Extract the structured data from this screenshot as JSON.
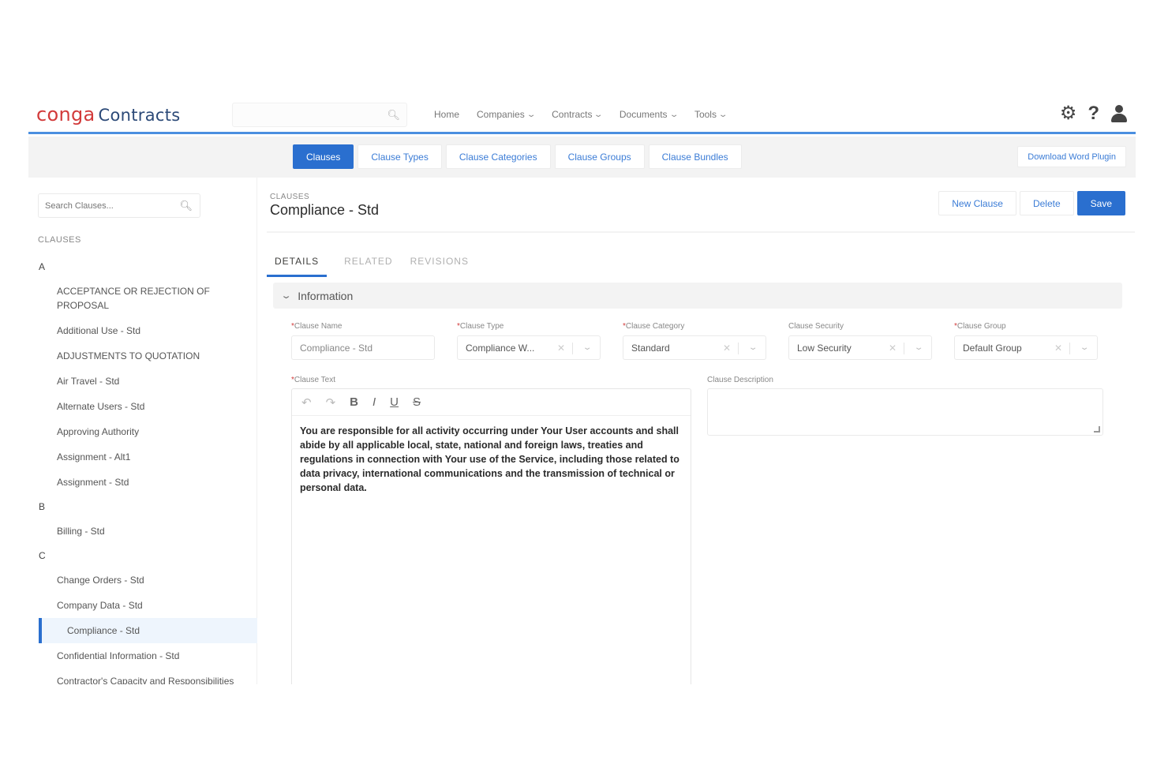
{
  "header": {
    "brand": "conga",
    "product": "Contracts",
    "nav": [
      "Home",
      "Companies",
      "Contracts",
      "Documents",
      "Tools"
    ],
    "nav_dropdown": [
      false,
      true,
      true,
      true,
      true
    ]
  },
  "subtabs": {
    "items": [
      "Clauses",
      "Clause Types",
      "Clause Categories",
      "Clause Groups",
      "Clause Bundles"
    ],
    "download_label": "Download Word Plugin"
  },
  "sidebar": {
    "search_placeholder": "Search Clauses...",
    "title": "CLAUSES",
    "groups": [
      {
        "letter": "A",
        "items": [
          "ACCEPTANCE OR REJECTION OF PROPOSAL",
          "Additional Use - Std",
          "ADJUSTMENTS TO QUOTATION",
          "Air Travel - Std",
          "Alternate Users - Std",
          "Approving Authority",
          "Assignment - Alt1",
          "Assignment - Std"
        ]
      },
      {
        "letter": "B",
        "items": [
          "Billing - Std"
        ]
      },
      {
        "letter": "C",
        "items": [
          "Change Orders - Std",
          "Company Data - Std",
          "Compliance - Std",
          "Confidential Information - Std",
          "Contractor's Capacity and Responsibilities"
        ]
      }
    ],
    "selected": "Compliance - Std"
  },
  "main": {
    "crumb": "CLAUSES",
    "title": "Compliance - Std",
    "actions": {
      "new": "New Clause",
      "delete": "Delete",
      "save": "Save"
    },
    "tabs": [
      "DETAILS",
      "RELATED",
      "REVISIONS"
    ],
    "section": "Information",
    "fields": {
      "clause_name": {
        "label": "Clause Name",
        "value": "Compliance - Std"
      },
      "clause_type": {
        "label": "Clause Type",
        "value": "Compliance W..."
      },
      "clause_category": {
        "label": "Clause Category",
        "value": "Standard"
      },
      "clause_security": {
        "label": "Clause Security",
        "value": "Low Security"
      },
      "clause_group": {
        "label": "Clause Group",
        "value": "Default Group"
      },
      "clause_text": {
        "label": "Clause Text",
        "value": "You are responsible for all activity occurring under Your User accounts and shall abide by all applicable local, state, national and foreign laws, treaties and regulations in connection with Your use of the Service, including those related to data privacy, international communications and the transmission of technical or personal data."
      },
      "clause_description": {
        "label": "Clause Description",
        "value": ""
      }
    },
    "toolbar_icons": [
      "undo-icon",
      "redo-icon",
      "bold-icon",
      "italic-icon",
      "underline-icon",
      "strikethrough-icon"
    ]
  },
  "colors": {
    "accent": "#2a6fcf",
    "brand_red": "#d23a3a",
    "header_line": "#4a8fe0"
  }
}
